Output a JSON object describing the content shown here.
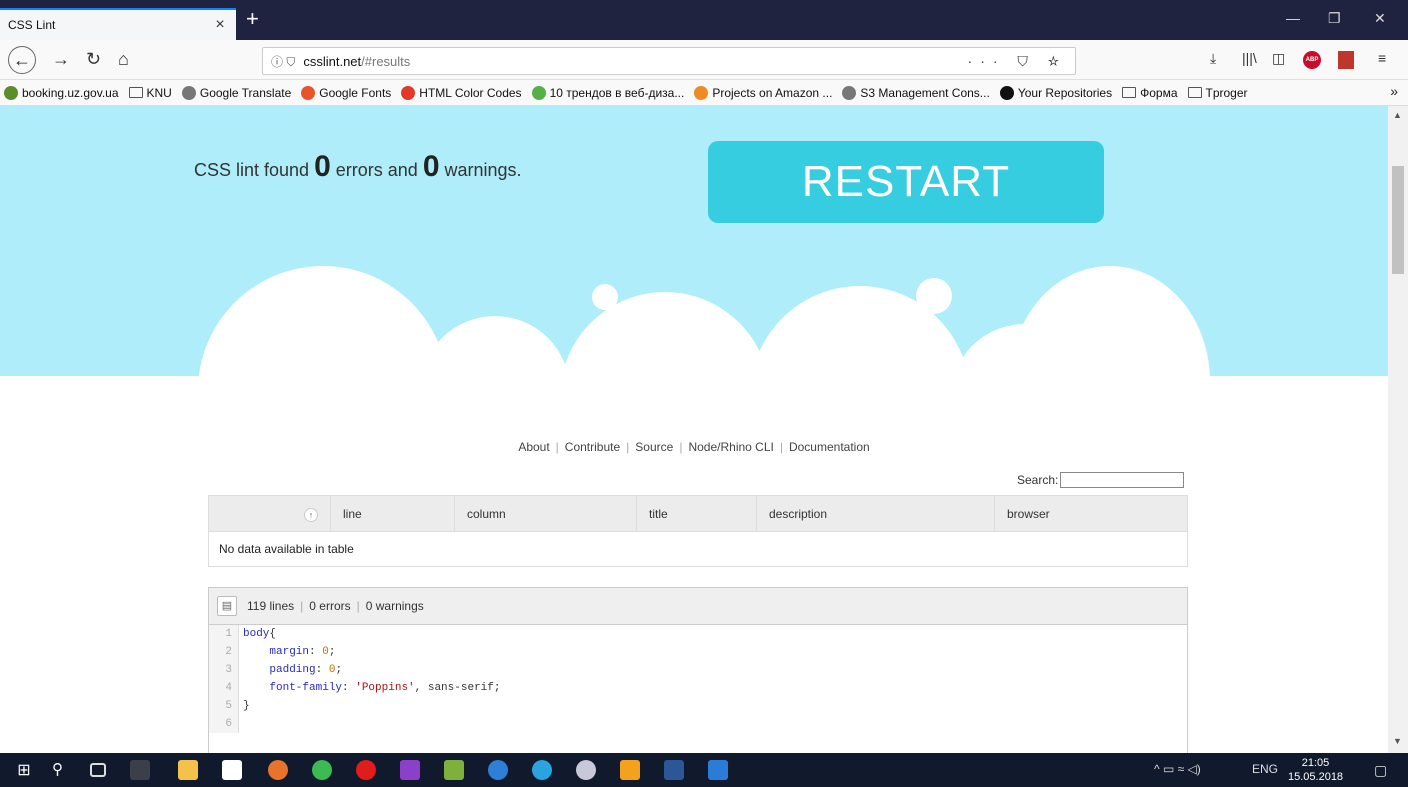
{
  "browser": {
    "tab_title": "CSS Lint",
    "tab_close": "×",
    "new_tab": "+",
    "url_host": "csslint.net",
    "url_path": "/#results",
    "url_prefix_icons": "ⓘ ⛉",
    "url_right_icons": "··· ⛉ ☆"
  },
  "bookmarks": [
    {
      "label": "booking.uz.gov.ua",
      "icon": "booking-favicon",
      "color": "#5a8d2c"
    },
    {
      "label": "KNU",
      "icon": "folder-icon",
      "color": ""
    },
    {
      "label": "Google Translate",
      "icon": "globe-icon",
      "color": "#777"
    },
    {
      "label": "Google Fonts",
      "icon": "google-fonts-icon",
      "color": "#e8552b"
    },
    {
      "label": "HTML Color Codes",
      "icon": "html-color-codes-icon",
      "color": "#e4392a"
    },
    {
      "label": "10 трендов в веб-диза...",
      "icon": "trends-icon",
      "color": "#56b047"
    },
    {
      "label": "Projects on Amazon ...",
      "icon": "amazon-icon",
      "color": "#f08a24"
    },
    {
      "label": "S3 Management Cons...",
      "icon": "globe-icon",
      "color": "#777"
    },
    {
      "label": "Your Repositories",
      "icon": "github-icon",
      "color": "#111"
    },
    {
      "label": "Форма",
      "icon": "folder-icon",
      "color": ""
    },
    {
      "label": "Tproger",
      "icon": "folder-icon",
      "color": ""
    }
  ],
  "bookmarks_more": "»",
  "hero": {
    "msg_prefix": "CSS lint found ",
    "errors": "0",
    "msg_mid": " errors and ",
    "warnings": "0",
    "msg_suffix": " warnings.",
    "restart_label": "RESTART"
  },
  "footer_links": [
    "About",
    "Contribute",
    "Source",
    "Node/Rhino CLI",
    "Documentation"
  ],
  "search_label": "Search:",
  "table": {
    "columns": [
      "line",
      "column",
      "title",
      "description",
      "browser"
    ],
    "sort_icon": "↑",
    "empty_text": "No data available in table"
  },
  "code": {
    "summary_lines": "119 lines",
    "summary_errors": "0 errors",
    "summary_warnings": "0 warnings",
    "line_numbers": [
      "1",
      "2",
      "3",
      "4",
      "5",
      "6"
    ],
    "l1_sel": "body",
    "l1_brace": "{",
    "l2_prop": "margin",
    "l2_val": "0",
    "l3_prop": "padding",
    "l3_val": "0",
    "l4_prop": "font-family",
    "l4_str": "'Poppins'",
    "l4_rest": ", sans-serif;",
    "l5": "}",
    "colon": ": ",
    "semicolon": ";"
  },
  "taskbar": {
    "lang": "ENG",
    "time": "21:05",
    "date": "15.05.2018"
  },
  "colors": {
    "hero_bg": "#aeedf9",
    "restart_bg": "#36cde0",
    "titlebar_bg": "#202340",
    "taskbar_bg": "#101a2c"
  }
}
